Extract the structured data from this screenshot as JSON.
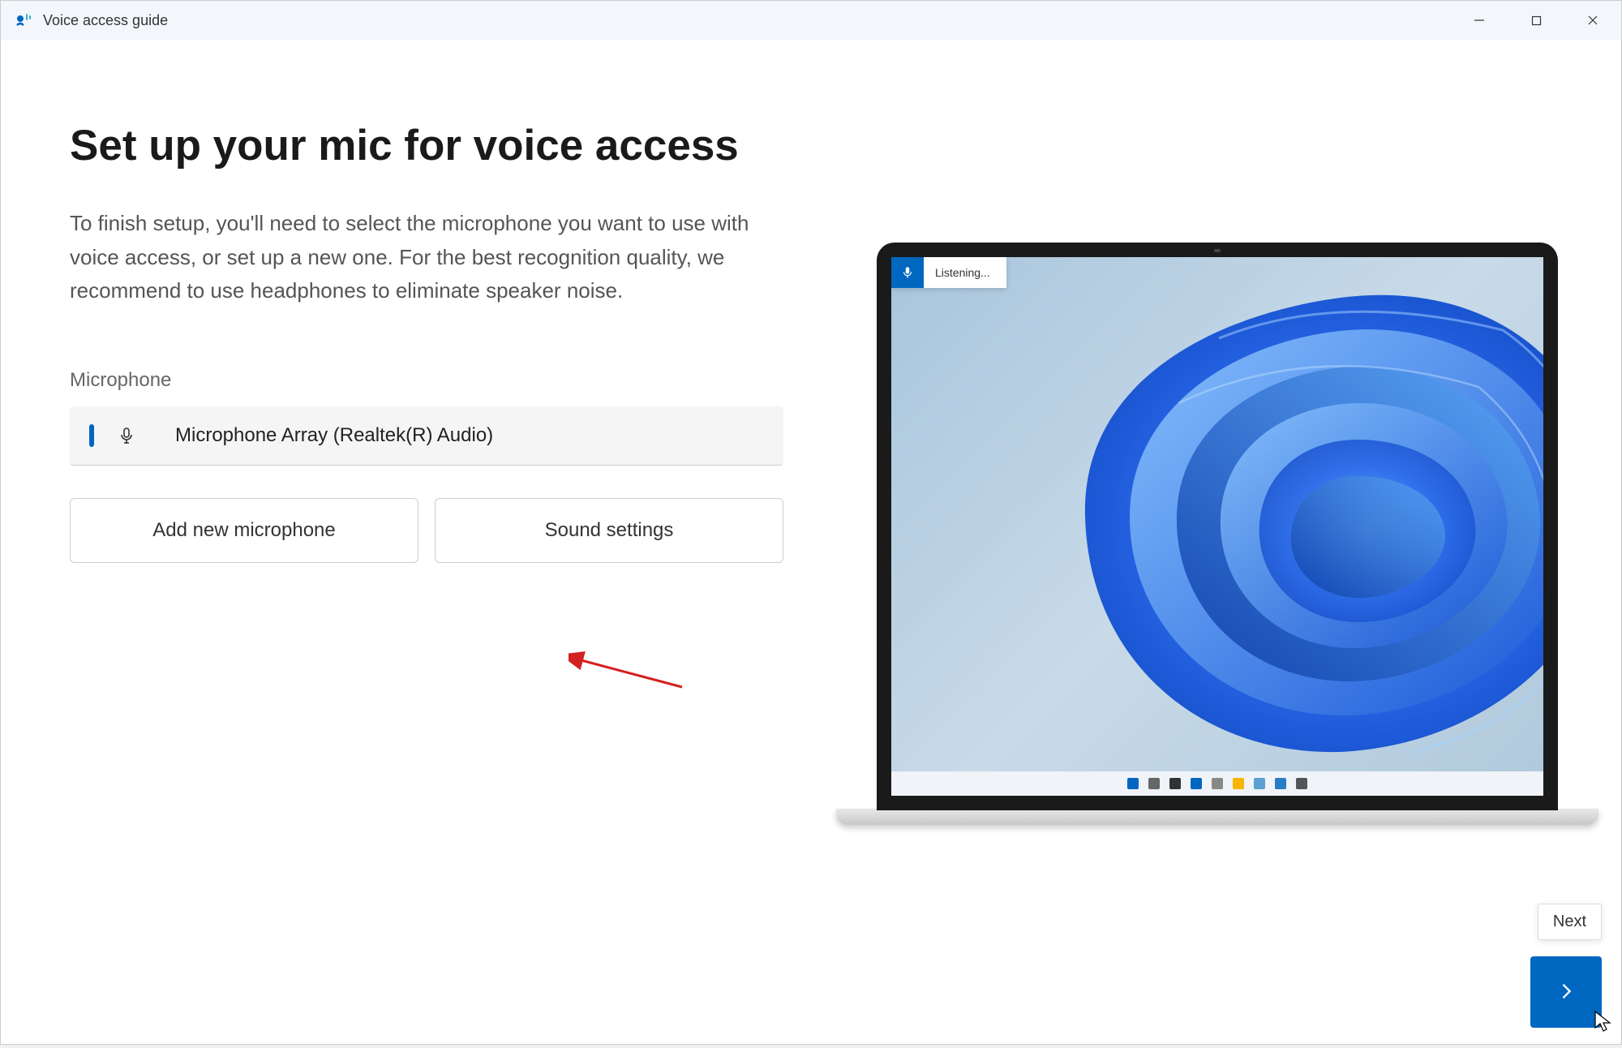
{
  "titlebar": {
    "title": "Voice access guide"
  },
  "main": {
    "heading": "Set up your mic for voice access",
    "description": "To finish setup, you'll need to select the microphone you want to use with voice access, or set up a new one. For the best recognition quality, we recommend to use headphones to eliminate speaker noise.",
    "mic_label": "Microphone",
    "mic_selected": "Microphone Array (Realtek(R) Audio)",
    "add_mic_label": "Add new microphone",
    "sound_settings_label": "Sound settings"
  },
  "preview": {
    "listening_label": "Listening..."
  },
  "footer": {
    "next_tooltip": "Next"
  },
  "colors": {
    "accent": "#0067c0"
  }
}
